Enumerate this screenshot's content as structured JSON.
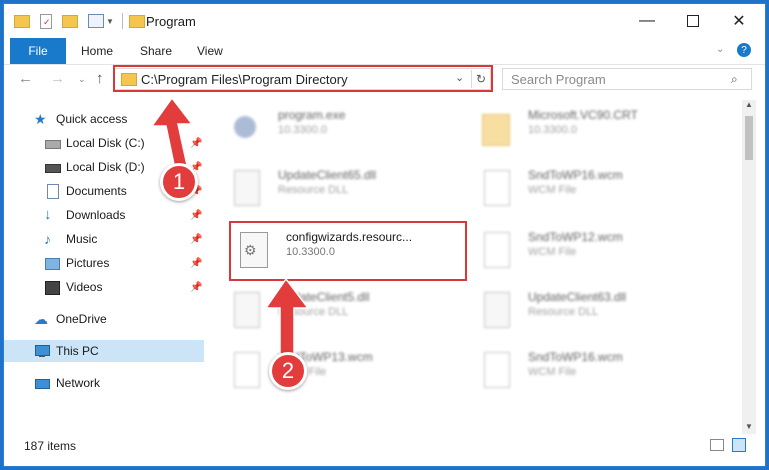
{
  "window": {
    "title": "Program",
    "controls": [
      "minimize",
      "maximize",
      "close"
    ]
  },
  "ribbon": {
    "tabs": [
      "File",
      "Home",
      "Share",
      "View"
    ]
  },
  "navigation": {
    "address": "C:\\Program Files\\Program Directory",
    "search_placeholder": "Search Program"
  },
  "sidebar": {
    "items": [
      {
        "label": "Quick access",
        "icon": "star-icon"
      },
      {
        "label": "Local Disk (C:)",
        "icon": "drive-icon",
        "pinned": true
      },
      {
        "label": "Local Disk (D:)",
        "icon": "drive-icon",
        "pinned": true
      },
      {
        "label": "Documents",
        "icon": "documents-icon",
        "pinned": true
      },
      {
        "label": "Downloads",
        "icon": "download-icon",
        "pinned": true
      },
      {
        "label": "Music",
        "icon": "music-icon",
        "pinned": true
      },
      {
        "label": "Pictures",
        "icon": "pictures-icon",
        "pinned": true
      },
      {
        "label": "Videos",
        "icon": "videos-icon",
        "pinned": true
      },
      {
        "label": "OneDrive",
        "icon": "cloud-icon"
      },
      {
        "label": "This PC",
        "icon": "computer-icon",
        "selected": true
      },
      {
        "label": "Network",
        "icon": "network-icon"
      }
    ]
  },
  "files": [
    {
      "name": "program.exe",
      "sub": "10.3300.0",
      "icon": "exe-icon"
    },
    {
      "name": "Microsoft.VC90.CRT",
      "sub": "10.3300.0",
      "icon": "folder-icon"
    },
    {
      "name": "UpdateClient65.dll",
      "sub": "Resource DLL",
      "icon": "dll-icon"
    },
    {
      "name": "SndToWP16.wcm",
      "sub": "WCM File",
      "icon": "file-icon"
    },
    {
      "name": "configwizards.resourc...",
      "sub": "10.3300.0",
      "icon": "dll-icon"
    },
    {
      "name": "SndToWP12.wcm",
      "sub": "WCM File",
      "icon": "file-icon"
    },
    {
      "name": "UpdateClient5.dll",
      "sub": "Resource DLL",
      "icon": "dll-icon"
    },
    {
      "name": "UpdateClient63.dll",
      "sub": "Resource DLL",
      "icon": "dll-icon"
    },
    {
      "name": "SndToWP13.wcm",
      "sub": "WCM File",
      "icon": "file-icon"
    },
    {
      "name": "SndToWP16.wcm",
      "sub": "WCM File",
      "icon": "file-icon"
    }
  ],
  "status": {
    "item_count": "187 items"
  },
  "annotations": {
    "callout_1": "1",
    "callout_2": "2",
    "highlight_color": "#d9383a"
  },
  "colors": {
    "accent": "#1979ca",
    "selected": "#cce4f7"
  }
}
